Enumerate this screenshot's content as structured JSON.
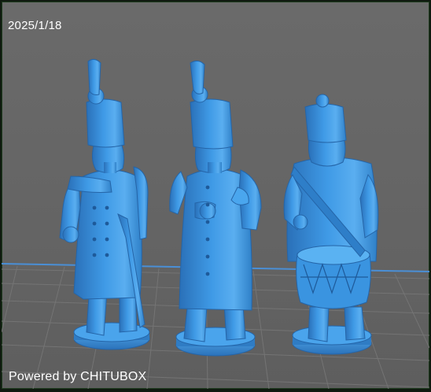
{
  "viewport": {
    "date": "2025/1/18",
    "watermark": "Powered by CHITUBOX"
  },
  "colors": {
    "background": "#666666",
    "grid": "#727272",
    "axis": "#4a8fd6",
    "model": "#3f9ae6",
    "model_shadow": "#2a70b8",
    "model_highlight": "#69b8f5",
    "frame": "#1e3a1e"
  },
  "scene": {
    "models": [
      "figure-officer-left",
      "figure-officer-center",
      "figure-drummer-right"
    ]
  }
}
